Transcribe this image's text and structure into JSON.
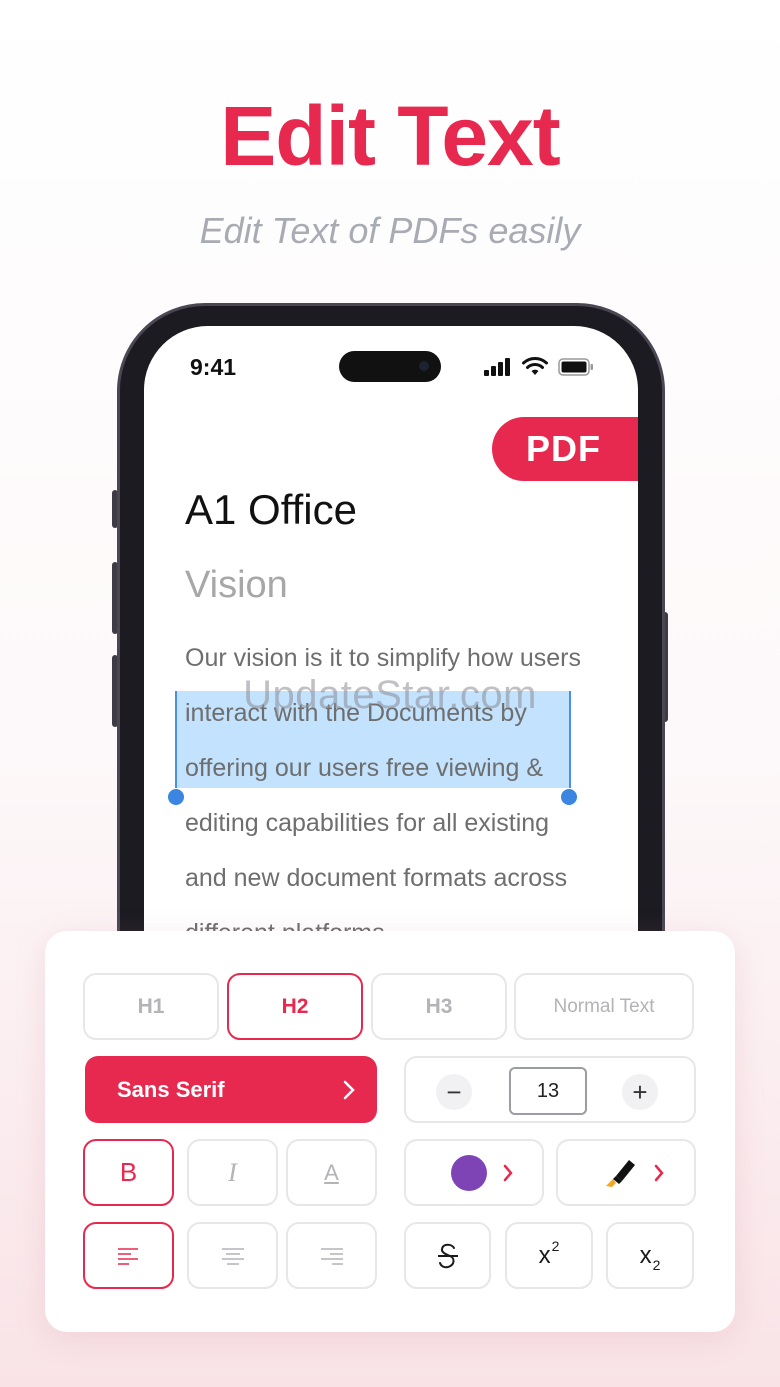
{
  "hero": {
    "title": "Edit Text",
    "subtitle": "Edit Text of PDFs easily"
  },
  "status_bar": {
    "time": "9:41"
  },
  "document": {
    "badge": "PDF",
    "title": "A1 Office",
    "heading": "Vision",
    "lines": [
      "Our vision is it to simplify how users",
      "interact with the Documents by",
      "offering our users free viewing &",
      "editing capabilities for all existing",
      "and new document formats across",
      "different platforms"
    ]
  },
  "watermark": "UpdateStar.com",
  "toolbar": {
    "styles": {
      "h1": "H1",
      "h2": "H2",
      "h3": "H3",
      "normal": "Normal Text",
      "selected": "H2"
    },
    "font_family": "Sans Serif",
    "font_size": "13",
    "decrease_symbol": "−",
    "increase_symbol": "+",
    "bold": "B",
    "italic": "I",
    "underline": "A",
    "superscript_base": "x",
    "superscript_exp": "2",
    "subscript_base": "x",
    "subscript_sub": "2",
    "text_color": "#7e44b6",
    "accent_color": "#e8294f",
    "alignment_selected": "left"
  }
}
